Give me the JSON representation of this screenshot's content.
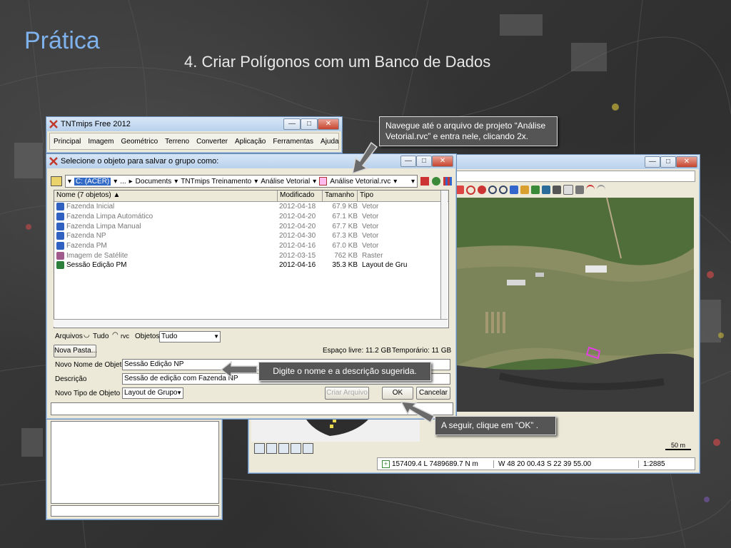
{
  "slide": {
    "title": "Prática",
    "subtitle": "4. Criar Polígonos com um Banco de Dados"
  },
  "tnt_window": {
    "title": "TNTmips Free 2012",
    "menu": [
      "Principal",
      "Imagem",
      "Geométrico",
      "Terreno",
      "Converter",
      "Aplicação",
      "Ferramentas",
      "Ajuda"
    ],
    "minimize": "—",
    "maximize": "□",
    "close": "✕"
  },
  "dialog": {
    "title": "Selecione o objeto para salvar o grupo como:",
    "minimize": "—",
    "maximize": "□",
    "close": "✕",
    "path": {
      "drive": "C: (ACER)",
      "ellipsis": "...",
      "segments": [
        "Documents",
        "TNTmips Treinamento",
        "Análise Vetorial",
        "Análise Vetorial.rvc"
      ]
    },
    "columns": [
      "Nome  (7 objetos)",
      "Modificado",
      "Tamanho",
      "Tipo"
    ],
    "files": [
      {
        "name": "Fazenda Inicial",
        "modified": "2012-04-18",
        "size": "67.9 KB",
        "type": "Vetor",
        "icon": "vector-icon",
        "color": "#3060c0",
        "dim": true
      },
      {
        "name": "Fazenda Limpa Automático",
        "modified": "2012-04-20",
        "size": "67.1 KB",
        "type": "Vetor",
        "icon": "vector-icon",
        "color": "#3060c0",
        "dim": true
      },
      {
        "name": "Fazenda Limpa Manual",
        "modified": "2012-04-20",
        "size": "67.7 KB",
        "type": "Vetor",
        "icon": "vector-icon",
        "color": "#3060c0",
        "dim": true
      },
      {
        "name": "Fazenda NP",
        "modified": "2012-04-30",
        "size": "67.3 KB",
        "type": "Vetor",
        "icon": "vector-icon",
        "color": "#3060c0",
        "dim": true
      },
      {
        "name": "Fazenda PM",
        "modified": "2012-04-16",
        "size": "67.0 KB",
        "type": "Vetor",
        "icon": "vector-icon",
        "color": "#3060c0",
        "dim": true
      },
      {
        "name": "Imagem de Satélite",
        "modified": "2012-03-15",
        "size": "762 KB",
        "type": "Raster",
        "icon": "raster-icon",
        "color": "#a05a8c",
        "dim": true
      },
      {
        "name": "Sessão Edição PM",
        "modified": "2012-04-16",
        "size": "35.3 KB",
        "type": "Layout de Grupo",
        "icon": "layout-icon",
        "color": "#2b7f3a",
        "dim": false
      }
    ],
    "arquivos_label": "Arquivos",
    "radio_tudo": "Tudo",
    "radio_rvc": "rvc",
    "objetos_label": "Objetos",
    "objetos_value": "Tudo",
    "nova_pasta": "Nova Pasta...",
    "espaco": "Espaço livre: 11.2 GB",
    "temporario": "Temporário: 11 GB",
    "nome_label": "Novo Nome de Objeto",
    "nome_value": "Sessão Edição NP",
    "descricao_label": "Descrição",
    "descricao_value": "Sessão de edição com Fazenda NP",
    "tipo_label": "Novo Tipo de Objeto",
    "tipo_value": "Layout de Grupo",
    "criar_arquivo": "Criar Arquivo",
    "ok": "OK",
    "cancelar": "Cancelar"
  },
  "viewer": {
    "minimize": "—",
    "maximize": "□",
    "close": "✕",
    "status_coords": "157409.4 L  7489689.7 N m",
    "status_geo": "W 48 20 00.43  S 22 39 55.00",
    "status_scale": "1:2885",
    "scalebar": "50 m"
  },
  "callouts": {
    "navigate": "Navegue até o arquivo de projeto “Análise Vetorial.rvc” e entra nele, clicando 2x.",
    "name": "Digite o nome e a descrição sugerida.",
    "ok": "A seguir, clique em “OK” ."
  }
}
